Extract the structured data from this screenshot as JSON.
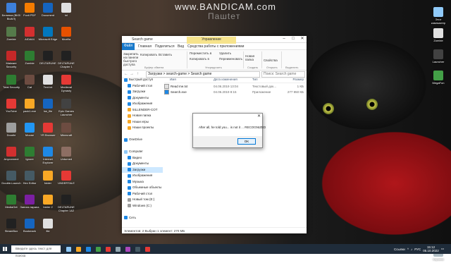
{
  "watermark": {
    "brand": "www.BANDICAM.com",
    "sub": "Пашteт"
  },
  "desktop_left": [
    {
      "label": "Белинка (ВКЛ/ВЫКЛ)",
      "color": "#3d7fd9"
    },
    {
      "label": "Zombie",
      "color": "#557a4a"
    },
    {
      "label": "Malware Security",
      "color": "#c62828"
    },
    {
      "label": "Total Security",
      "color": "#2e7d32"
    },
    {
      "label": "YouTube",
      "color": "#e53935"
    },
    {
      "label": "Doodle",
      "color": "#9e9e9e"
    },
    {
      "label": "Anyconnect",
      "color": "#d32f2f"
    },
    {
      "label": "Double-Launch",
      "color": "#455a64"
    },
    {
      "label": "MediaGet",
      "color": "#2e7d32"
    },
    {
      "label": "SteamBox",
      "color": "#212121"
    },
    {
      "label": "Foxit PDF",
      "color": "#f57c00"
    },
    {
      "label": "AIDA64",
      "color": "#d32f2f"
    },
    {
      "label": "Zombie",
      "color": "#2e7d32"
    },
    {
      "label": "Cat",
      "color": "#6d4c41"
    },
    {
      "label": "pack1.exe",
      "color": "#f9a825"
    },
    {
      "label": "Mouse",
      "color": "#2196f3"
    },
    {
      "label": "Ignore",
      "color": "#2e7d32"
    },
    {
      "label": "Hex Editor",
      "color": "#455a64"
    },
    {
      "label": "Запись экрана",
      "color": "#7b1fa2"
    },
    {
      "label": "Bookmark",
      "color": "#1565c0"
    },
    {
      "label": "Document",
      "color": "#1565c0"
    },
    {
      "label": "Microsoft Edge",
      "color": "#0277bd"
    },
    {
      "label": "DELTARUNE",
      "color": "#212121"
    },
    {
      "label": "Text.txt",
      "color": "#e0e0e0"
    },
    {
      "label": "hw_file",
      "color": "#1565c0"
    },
    {
      "label": "YR Browser",
      "color": "#e53935"
    },
    {
      "label": "Internet Explorer",
      "color": "#1e88e5"
    },
    {
      "label": "folder",
      "color": "#f9a825"
    },
    {
      "label": "folder 2",
      "color": "#f9a825"
    },
    {
      "label": "file",
      "color": "#e0e0e0"
    },
    {
      "label": "ini",
      "color": "#e0e0e0"
    },
    {
      "label": "Mozilla",
      "color": "#e65100"
    },
    {
      "label": "DELTARUNE Chapter 1",
      "color": "#212121"
    },
    {
      "label": "Medieval Dynasty",
      "color": "#e53935"
    },
    {
      "label": "Epic Games Launcher",
      "color": "#424242"
    },
    {
      "label": "Minecraft",
      "color": "#6d4c41"
    },
    {
      "label": "Unturned",
      "color": "#8d6e63"
    },
    {
      "label": "UNDERTALE",
      "color": "#e53935"
    },
    {
      "label": "DELTARUNE Chapter 1&2",
      "color": "#212121"
    }
  ],
  "desktop_right": [
    {
      "label": "Этот компьютер",
      "color": "#90caf9"
    },
    {
      "label": "Zombie",
      "color": "#e0e0e0"
    },
    {
      "label": "Launcher",
      "color": "#424242"
    },
    {
      "label": "MegaFon",
      "color": "#43a047"
    },
    {
      "label": "Корзина",
      "color": "#b0bec5"
    }
  ],
  "explorer": {
    "title": "Search game",
    "tabs": [
      "Файл",
      "Главная",
      "Поделиться",
      "Вид",
      "Средства работы с приложениями"
    ],
    "manage_tab": "Управление",
    "ribbon": {
      "pin": "Закрепить на панели быстрого доступа",
      "copy": "Копировать",
      "paste": "Вставить",
      "clipboard": "Буфер обмена",
      "move_to": "Переместить в",
      "copy_to": "Копировать в",
      "delete": "Удалить",
      "rename": "Переименовать",
      "organize": "Упорядочить",
      "new_folder": "Новая папка",
      "create": "Создать",
      "properties": "Свойства",
      "open": "Открыть",
      "select": "Выделить"
    },
    "address": "Загрузки > search-game > Search game",
    "search_placeholder": "Поиск: Search game",
    "nav": [
      {
        "label": "Быстрый доступ",
        "color": "#1e88e5",
        "sel": false
      },
      {
        "label": "Рабочий стол",
        "color": "#1e88e5",
        "sel": false
      },
      {
        "label": "Загрузки",
        "color": "#1e88e5",
        "sel": false
      },
      {
        "label": "Документы",
        "color": "#1e88e5",
        "sel": false
      },
      {
        "label": "Изображения",
        "color": "#1e88e5",
        "sel": false
      },
      {
        "label": "5ILLENDER-COT",
        "color": "#f9a825",
        "sel": false
      },
      {
        "label": "Новая папка",
        "color": "#f9a825",
        "sel": false
      },
      {
        "label": "Наши игры",
        "color": "#f9a825",
        "sel": false
      },
      {
        "label": "Наши проекты",
        "color": "#f9a825",
        "sel": false
      },
      {
        "label": "",
        "color": "transparent",
        "sel": false
      },
      {
        "label": "OneDrive",
        "color": "#1e88e5",
        "sel": false
      },
      {
        "label": "",
        "color": "transparent",
        "sel": false
      },
      {
        "label": "Computer",
        "color": "#90caf9",
        "sel": false
      },
      {
        "label": "Видео",
        "color": "#1e88e5",
        "sel": false
      },
      {
        "label": "Документы",
        "color": "#1e88e5",
        "sel": false
      },
      {
        "label": "Загрузки",
        "color": "#1e88e5",
        "sel": true
      },
      {
        "label": "Изображения",
        "color": "#1e88e5",
        "sel": false
      },
      {
        "label": "Музыка",
        "color": "#1e88e5",
        "sel": false
      },
      {
        "label": "Объемные объекты",
        "color": "#1e88e5",
        "sel": false
      },
      {
        "label": "Рабочий стол",
        "color": "#1e88e5",
        "sel": false
      },
      {
        "label": "Новый том (E:)",
        "color": "#9e9e9e",
        "sel": false
      },
      {
        "label": "Windows (C:)",
        "color": "#9e9e9e",
        "sel": false
      },
      {
        "label": "",
        "color": "transparent",
        "sel": false
      },
      {
        "label": "Сеть",
        "color": "#1e88e5",
        "sel": false
      }
    ],
    "columns": [
      "Имя",
      "Дата изменения",
      "Тип",
      "Размер"
    ],
    "files": [
      {
        "name": "Read me.txt",
        "date": "04.06.2019 13:04",
        "type": "Текстовый док...",
        "size": "1 КБ",
        "color": "#e0e0e0"
      },
      {
        "name": "Search.exe",
        "date": "04.06.2019 8:15",
        "type": "Приложение",
        "size": "277 950 КБ",
        "color": "#1e88e5"
      }
    ],
    "status": "Элементов: 2    Выбран 1 элемент: 270 МБ"
  },
  "dialog": {
    "message": "After all, he told you... is not it ... RECOGNIZED",
    "ok": "OK"
  },
  "taskbar": {
    "search": "Введите здесь текст для поиска",
    "apps": [
      {
        "name": "task-view",
        "color": "#90caf9"
      },
      {
        "name": "explorer",
        "color": "#f9a825"
      },
      {
        "name": "edge",
        "color": "#1e88e5"
      },
      {
        "name": "chrome",
        "color": "#43a047"
      },
      {
        "name": "yandex",
        "color": "#e53935"
      },
      {
        "name": "steam",
        "color": "#90a4ae"
      },
      {
        "name": "photo",
        "color": "#ab47bc"
      },
      {
        "name": "terminal",
        "color": "#455a64"
      },
      {
        "name": "bandicam",
        "color": "#e53935"
      }
    ],
    "tray_label": "Ссылки",
    "lang": "РУС",
    "time": "15:12",
    "date": "05.10.2022"
  }
}
